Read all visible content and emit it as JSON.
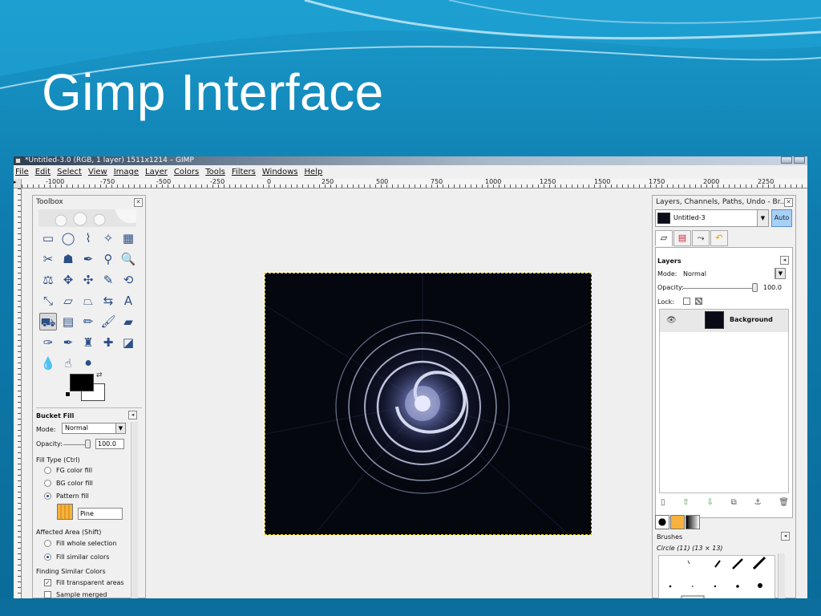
{
  "slide": {
    "title": "Gimp Interface"
  },
  "window": {
    "title": "*Untitled-3.0 (RGB, 1 layer) 1511x1214 – GIMP",
    "menus": [
      "File",
      "Edit",
      "Select",
      "View",
      "Image",
      "Layer",
      "Colors",
      "Tools",
      "Filters",
      "Windows",
      "Help"
    ],
    "ruler_ticks": [
      "-1000",
      "-750",
      "-500",
      "-250",
      "0",
      "250",
      "500",
      "750",
      "1000",
      "1250",
      "1500",
      "1750",
      "2000",
      "2250"
    ]
  },
  "toolbox": {
    "title": "Toolbox",
    "tools": [
      {
        "icon": "rect-select-icon",
        "glyph": "▭"
      },
      {
        "icon": "ellipse-select-icon",
        "glyph": "◯"
      },
      {
        "icon": "free-select-icon",
        "glyph": "⌇"
      },
      {
        "icon": "fuzzy-select-icon",
        "glyph": "✧"
      },
      {
        "icon": "color-select-icon",
        "glyph": "▦"
      },
      {
        "icon": "scissors-icon",
        "glyph": "✂"
      },
      {
        "icon": "foreground-select-icon",
        "glyph": "☗"
      },
      {
        "icon": "paths-icon",
        "glyph": "✒"
      },
      {
        "icon": "color-picker-icon",
        "glyph": "⚲"
      },
      {
        "icon": "zoom-icon",
        "glyph": "🔍"
      },
      {
        "icon": "measure-icon",
        "glyph": "⚖"
      },
      {
        "icon": "move-icon",
        "glyph": "✥"
      },
      {
        "icon": "align-icon",
        "glyph": "✣"
      },
      {
        "icon": "crop-icon",
        "glyph": "✎"
      },
      {
        "icon": "rotate-icon",
        "glyph": "⟲"
      },
      {
        "icon": "scale-icon",
        "glyph": "⤡"
      },
      {
        "icon": "shear-icon",
        "glyph": "▱"
      },
      {
        "icon": "perspective-icon",
        "glyph": "⏢"
      },
      {
        "icon": "flip-icon",
        "glyph": "⇆"
      },
      {
        "icon": "text-icon",
        "glyph": "A"
      },
      {
        "icon": "bucket-fill-icon",
        "glyph": "⛟"
      },
      {
        "icon": "blend-icon",
        "glyph": "▤"
      },
      {
        "icon": "pencil-icon",
        "glyph": "✏"
      },
      {
        "icon": "paintbrush-icon",
        "glyph": "🖌"
      },
      {
        "icon": "eraser-icon",
        "glyph": "▰"
      },
      {
        "icon": "airbrush-icon",
        "glyph": "✑"
      },
      {
        "icon": "ink-icon",
        "glyph": "✒"
      },
      {
        "icon": "clone-icon",
        "glyph": "♜"
      },
      {
        "icon": "heal-icon",
        "glyph": "✚"
      },
      {
        "icon": "perspective-clone-icon",
        "glyph": "◪"
      },
      {
        "icon": "blur-icon",
        "glyph": "💧"
      },
      {
        "icon": "smudge-icon",
        "glyph": "☝"
      },
      {
        "icon": "dodge-burn-icon",
        "glyph": "⚫"
      }
    ],
    "options": {
      "tool_name": "Bucket Fill",
      "mode_label": "Mode:",
      "mode_value": "Normal",
      "opacity_label": "Opacity:",
      "opacity_value": "100.0",
      "fill_type_label": "Fill Type  (Ctrl)",
      "fill_fg": "FG color fill",
      "fill_bg": "BG color fill",
      "fill_pattern": "Pattern fill",
      "pattern_name": "Pine",
      "affected_area_label": "Affected Area  (Shift)",
      "fill_whole": "Fill whole selection",
      "fill_similar": "Fill similar colors",
      "finding_label": "Finding Similar Colors",
      "fill_transparent": "Fill transparent areas",
      "sample_merged": "Sample merged"
    }
  },
  "dock": {
    "title": "Layers, Channels, Paths, Undo - Br...",
    "image_name": "Untitled-3",
    "auto_label": "Auto",
    "layers_label": "Layers",
    "mode_label": "Mode:",
    "mode_value": "Normal",
    "opacity_label": "Opacity:",
    "opacity_value": "100.0",
    "lock_label": "Lock:",
    "layer_name": "Background",
    "brushes_label": "Brushes",
    "brush_info": "Circle (11) (13 × 13)"
  },
  "colors": {
    "foreground": "#000000",
    "background": "#ffffff",
    "accent": "#1a9acb"
  }
}
